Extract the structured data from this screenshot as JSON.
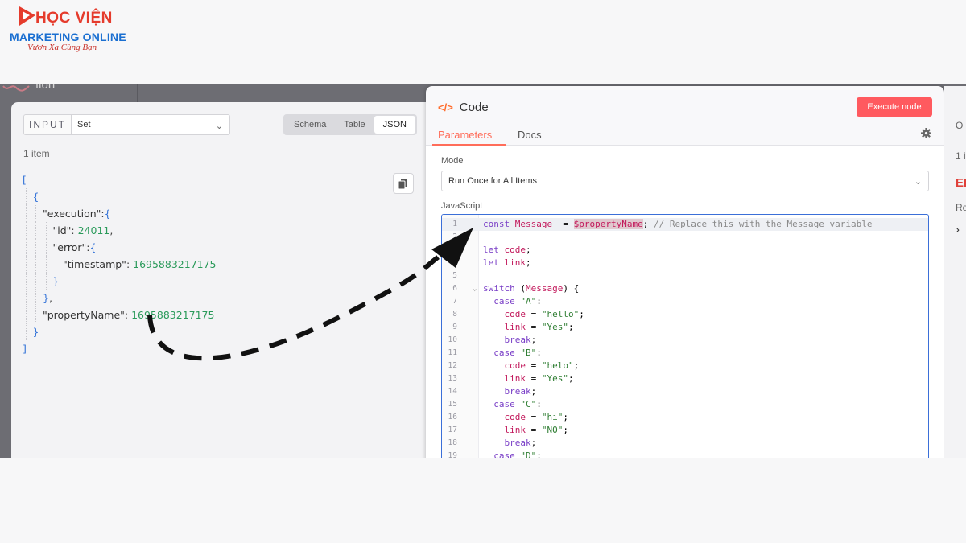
{
  "logo": {
    "title": "HỌC VIỆN",
    "subtitle": "MARKETING ONLINE",
    "tagline": "Vươn Xa Cùng Bạn"
  },
  "background": {
    "text": "flon"
  },
  "input_panel": {
    "label": "INPUT",
    "select_value": "Set",
    "view_tabs": [
      "Schema",
      "Table",
      "JSON"
    ],
    "active_view": "JSON",
    "item_count": "1 item",
    "json_lines": [
      {
        "k": "[",
        "t": "br",
        "d": 0
      },
      {
        "k": "{",
        "t": "br",
        "d": 1
      },
      {
        "k": "\"execution\"",
        "sep": ":",
        "v": "{",
        "vt": "br",
        "d": 2
      },
      {
        "k": "\"id\"",
        "sep": ": ",
        "v": "24011",
        "vt": "num",
        "after": ",",
        "d": 3
      },
      {
        "k": "\"error\"",
        "sep": ":",
        "v": "{",
        "vt": "br",
        "d": 3
      },
      {
        "k": "\"timestamp\"",
        "sep": ": ",
        "v": "1695883217175",
        "vt": "num",
        "d": 4
      },
      {
        "k": "}",
        "t": "br",
        "d": 3
      },
      {
        "k": "}",
        "t": "br",
        "after": ",",
        "d": 2
      },
      {
        "k": "\"propertyName\"",
        "sep": ": ",
        "v": "1695883217175",
        "vt": "num",
        "d": 2
      },
      {
        "k": "}",
        "t": "br",
        "d": 1
      },
      {
        "k": "]",
        "t": "br",
        "d": 0
      }
    ]
  },
  "code_panel": {
    "title": "Code",
    "execute_label": "Execute node",
    "tabs": [
      "Parameters",
      "Docs"
    ],
    "mode_label": "Mode",
    "mode_value": "Run Once for All Items",
    "js_label": "JavaScript",
    "code_lines": [
      [
        [
          "kw",
          "const "
        ],
        [
          "vr",
          "Message"
        ],
        [
          "",
          "  = "
        ],
        [
          "hl",
          "$propertyName"
        ],
        [
          "",
          ";"
        ],
        [
          "cm",
          " // Replace this with the Message variable"
        ]
      ],
      [],
      [
        [
          "kw",
          "let "
        ],
        [
          "vr",
          "code"
        ],
        [
          "",
          ";"
        ]
      ],
      [
        [
          "kw",
          "let "
        ],
        [
          "vr",
          "link"
        ],
        [
          "",
          ";"
        ]
      ],
      [],
      [
        [
          "kw",
          "switch "
        ],
        [
          "",
          "("
        ],
        [
          "vr",
          "Message"
        ],
        [
          "",
          ") {"
        ]
      ],
      [
        [
          "",
          "  "
        ],
        [
          "kw",
          "case "
        ],
        [
          "st",
          "\"A\""
        ],
        [
          "",
          ":"
        ]
      ],
      [
        [
          "",
          "    "
        ],
        [
          "vr",
          "code"
        ],
        [
          "",
          " = "
        ],
        [
          "st",
          "\"hello\""
        ],
        [
          "",
          ";"
        ]
      ],
      [
        [
          "",
          "    "
        ],
        [
          "vr",
          "link"
        ],
        [
          "",
          " = "
        ],
        [
          "st",
          "\"Yes\""
        ],
        [
          "",
          ";"
        ]
      ],
      [
        [
          "",
          "    "
        ],
        [
          "kw",
          "break"
        ],
        [
          "",
          ";"
        ]
      ],
      [
        [
          "",
          "  "
        ],
        [
          "kw",
          "case "
        ],
        [
          "st",
          "\"B\""
        ],
        [
          "",
          ":"
        ]
      ],
      [
        [
          "",
          "    "
        ],
        [
          "vr",
          "code"
        ],
        [
          "",
          " = "
        ],
        [
          "st",
          "\"helo\""
        ],
        [
          "",
          ";"
        ]
      ],
      [
        [
          "",
          "    "
        ],
        [
          "vr",
          "link"
        ],
        [
          "",
          " = "
        ],
        [
          "st",
          "\"Yes\""
        ],
        [
          "",
          ";"
        ]
      ],
      [
        [
          "",
          "    "
        ],
        [
          "kw",
          "break"
        ],
        [
          "",
          ";"
        ]
      ],
      [
        [
          "",
          "  "
        ],
        [
          "kw",
          "case "
        ],
        [
          "st",
          "\"C\""
        ],
        [
          "",
          ":"
        ]
      ],
      [
        [
          "",
          "    "
        ],
        [
          "vr",
          "code"
        ],
        [
          "",
          " = "
        ],
        [
          "st",
          "\"hi\""
        ],
        [
          "",
          ";"
        ]
      ],
      [
        [
          "",
          "    "
        ],
        [
          "vr",
          "link"
        ],
        [
          "",
          " = "
        ],
        [
          "st",
          "\"NO\""
        ],
        [
          "",
          ";"
        ]
      ],
      [
        [
          "",
          "    "
        ],
        [
          "kw",
          "break"
        ],
        [
          "",
          ";"
        ]
      ],
      [
        [
          "",
          "  "
        ],
        [
          "kw",
          "case "
        ],
        [
          "st",
          "\"D\""
        ],
        [
          "",
          ":"
        ]
      ]
    ]
  },
  "output_panel": {
    "header": "O",
    "count": "1 i",
    "error": "EI",
    "text": "Re",
    "chevron": "›"
  },
  "colors": {
    "accent": "#ff6d5a",
    "execute": "#ff5a5f",
    "json_bracket": "#3574d8",
    "json_number": "#2a9a5a"
  }
}
